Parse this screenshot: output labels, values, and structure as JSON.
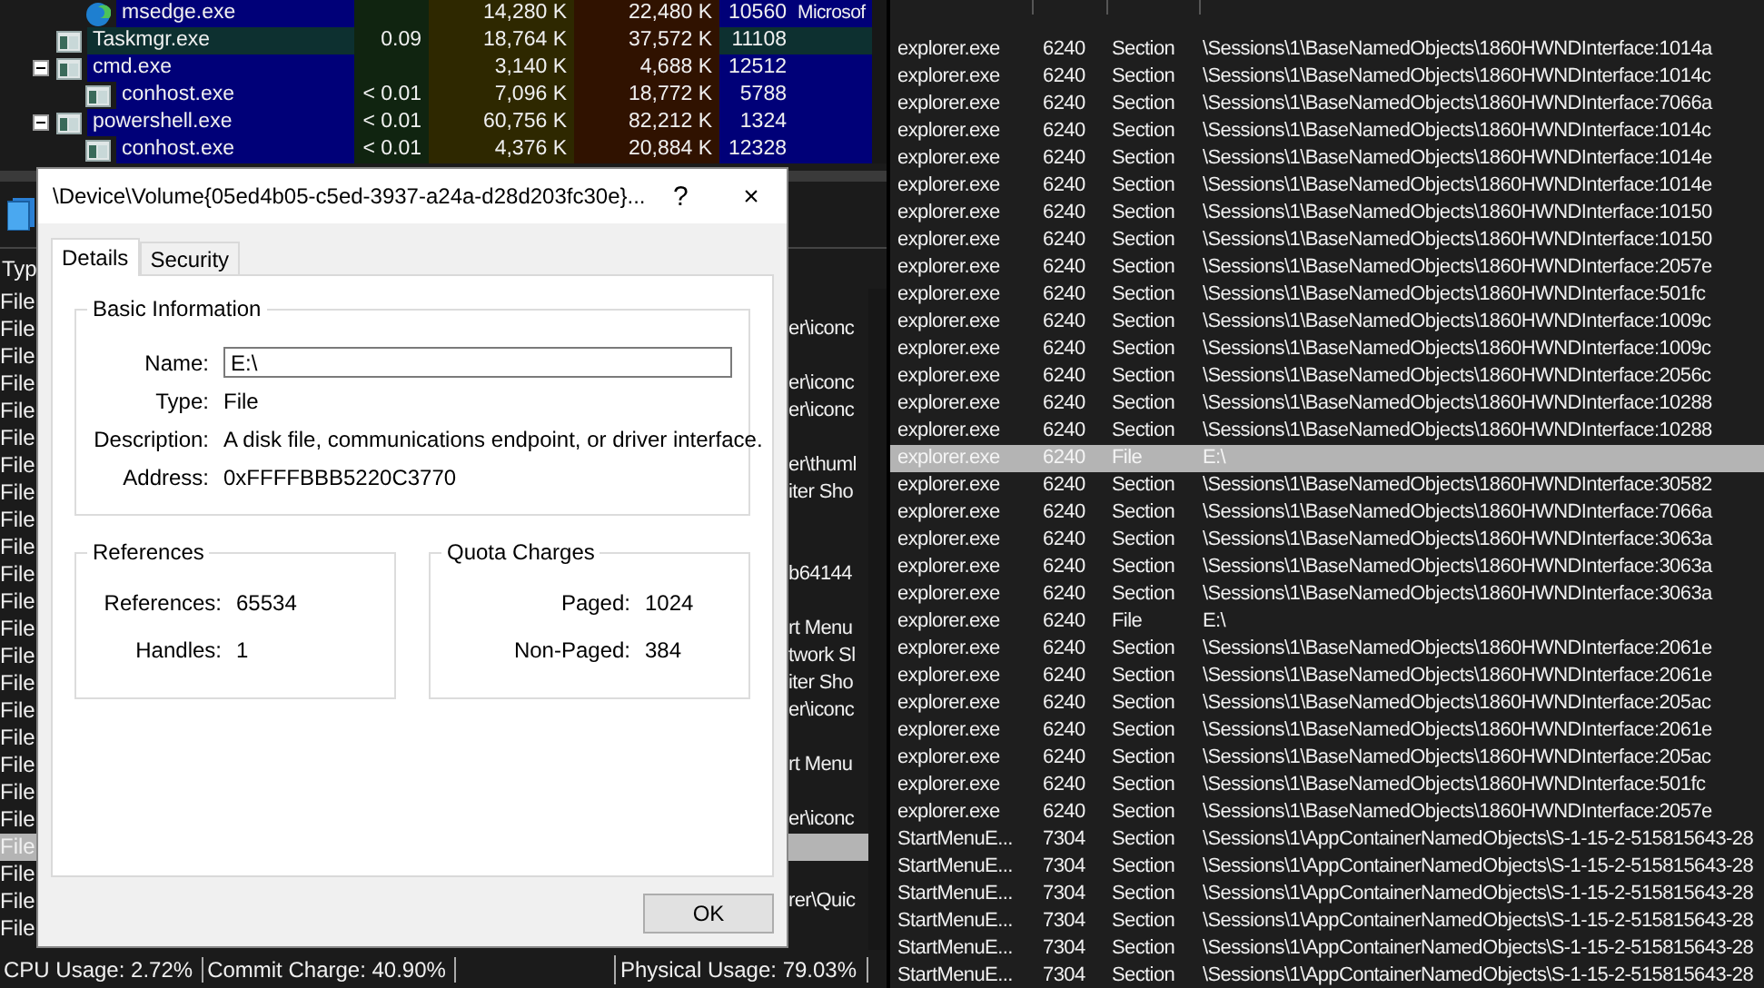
{
  "process_tree": {
    "leading_child_rows": [
      {
        "name": "msedge.exe",
        "cpu": "",
        "private_bytes": "14,280 K",
        "working_set": "22,480 K",
        "pid": "10560",
        "description": "Microsof",
        "highlighted": false
      }
    ],
    "rows": [
      {
        "name": "Taskmgr.exe",
        "cpu": "0.09",
        "private_bytes": "18,764 K",
        "working_set": "37,572 K",
        "pid": "11108",
        "highlighted": true
      },
      {
        "name": "cmd.exe",
        "cpu": "",
        "private_bytes": "3,140 K",
        "working_set": "4,688 K",
        "pid": "12512",
        "highlighted": false,
        "expanded": true,
        "children": [
          {
            "name": "conhost.exe",
            "cpu": "< 0.01",
            "private_bytes": "7,096 K",
            "working_set": "18,772 K",
            "pid": "5788",
            "highlighted": false
          }
        ]
      },
      {
        "name": "powershell.exe",
        "cpu": "< 0.01",
        "private_bytes": "60,756 K",
        "working_set": "82,212 K",
        "pid": "1324",
        "highlighted": false,
        "expanded": true,
        "children": [
          {
            "name": "conhost.exe",
            "cpu": "< 0.01",
            "private_bytes": "4,376 K",
            "working_set": "20,884 K",
            "pid": "12328",
            "highlighted": false
          }
        ]
      }
    ]
  },
  "lower_pane": {
    "header": "Typ",
    "rows": [
      {
        "type": "File",
        "selected": false
      },
      {
        "type": "File",
        "name_tail": "er\\iconc",
        "selected": false
      },
      {
        "type": "File",
        "selected": false
      },
      {
        "type": "File",
        "name_tail": "er\\iconc",
        "selected": false
      },
      {
        "type": "File",
        "name_tail": "er\\iconc",
        "selected": false
      },
      {
        "type": "File",
        "selected": false
      },
      {
        "type": "File",
        "name_tail": "er\\thuml",
        "selected": false
      },
      {
        "type": "File",
        "name_tail": "iter Sho",
        "selected": false
      },
      {
        "type": "File",
        "selected": false
      },
      {
        "type": "File",
        "selected": false
      },
      {
        "type": "File",
        "name_tail": "b64144",
        "selected": false
      },
      {
        "type": "File",
        "selected": false
      },
      {
        "type": "File",
        "name_tail": "rt Menu",
        "selected": false
      },
      {
        "type": "File",
        "name_tail": "twork Sl",
        "selected": false
      },
      {
        "type": "File",
        "name_tail": "iter Sho",
        "selected": false
      },
      {
        "type": "File",
        "name_tail": "er\\iconc",
        "selected": false
      },
      {
        "type": "File",
        "selected": false
      },
      {
        "type": "File",
        "name_tail": "rt Menu",
        "selected": false
      },
      {
        "type": "File",
        "selected": false
      },
      {
        "type": "File",
        "name_tail": "er\\iconc",
        "selected": false
      },
      {
        "type": "File",
        "selected": true
      },
      {
        "type": "File",
        "selected": false
      },
      {
        "type": "File",
        "name_tail": "rer\\Quic",
        "selected": false
      },
      {
        "type": "File",
        "selected": false
      }
    ]
  },
  "status_bar": [
    "CPU Usage: 2.72%",
    "Commit Charge: 40.90%",
    "Physical Usage: 79.03%"
  ],
  "dialog": {
    "title": "\\Device\\Volume{05ed4b05-c5ed-3937-a24a-d28d203fc30e}...",
    "help": "?",
    "close": "×",
    "tabs": [
      {
        "label": "Details",
        "selected": true
      },
      {
        "label": "Security",
        "selected": false
      }
    ],
    "basic_information": {
      "title": "Basic Information",
      "fields": [
        {
          "kind": "input",
          "label": "Name:",
          "value": "E:\\"
        },
        {
          "kind": "text",
          "label": "Type:",
          "value": "File"
        },
        {
          "kind": "text",
          "label": "Description:",
          "value": "A disk file, communications endpoint, or driver interface."
        },
        {
          "kind": "text",
          "label": "Address:",
          "value": "0xFFFFBBB5220C3770"
        }
      ]
    },
    "references": {
      "title": "References",
      "fields": [
        {
          "label": "References:",
          "value": "65534"
        },
        {
          "label": "Handles:",
          "value": "1"
        }
      ]
    },
    "quota_charges": {
      "title": "Quota Charges",
      "fields": [
        {
          "label": "Paged:",
          "value": "1024"
        },
        {
          "label": "Non-Paged:",
          "value": "384"
        }
      ]
    },
    "ok_button": "OK"
  },
  "handles": {
    "rows": [
      {
        "process": "explorer.exe",
        "pid": "6240",
        "type": "Section",
        "name": "\\Sessions\\1\\BaseNamedObjects\\1860HWNDInterface:1014a",
        "selected": false
      },
      {
        "process": "explorer.exe",
        "pid": "6240",
        "type": "Section",
        "name": "\\Sessions\\1\\BaseNamedObjects\\1860HWNDInterface:1014c",
        "selected": false
      },
      {
        "process": "explorer.exe",
        "pid": "6240",
        "type": "Section",
        "name": "\\Sessions\\1\\BaseNamedObjects\\1860HWNDInterface:7066a",
        "selected": false
      },
      {
        "process": "explorer.exe",
        "pid": "6240",
        "type": "Section",
        "name": "\\Sessions\\1\\BaseNamedObjects\\1860HWNDInterface:1014c",
        "selected": false
      },
      {
        "process": "explorer.exe",
        "pid": "6240",
        "type": "Section",
        "name": "\\Sessions\\1\\BaseNamedObjects\\1860HWNDInterface:1014e",
        "selected": false
      },
      {
        "process": "explorer.exe",
        "pid": "6240",
        "type": "Section",
        "name": "\\Sessions\\1\\BaseNamedObjects\\1860HWNDInterface:1014e",
        "selected": false
      },
      {
        "process": "explorer.exe",
        "pid": "6240",
        "type": "Section",
        "name": "\\Sessions\\1\\BaseNamedObjects\\1860HWNDInterface:10150",
        "selected": false
      },
      {
        "process": "explorer.exe",
        "pid": "6240",
        "type": "Section",
        "name": "\\Sessions\\1\\BaseNamedObjects\\1860HWNDInterface:10150",
        "selected": false
      },
      {
        "process": "explorer.exe",
        "pid": "6240",
        "type": "Section",
        "name": "\\Sessions\\1\\BaseNamedObjects\\1860HWNDInterface:2057e",
        "selected": false
      },
      {
        "process": "explorer.exe",
        "pid": "6240",
        "type": "Section",
        "name": "\\Sessions\\1\\BaseNamedObjects\\1860HWNDInterface:501fc",
        "selected": false
      },
      {
        "process": "explorer.exe",
        "pid": "6240",
        "type": "Section",
        "name": "\\Sessions\\1\\BaseNamedObjects\\1860HWNDInterface:1009c",
        "selected": false
      },
      {
        "process": "explorer.exe",
        "pid": "6240",
        "type": "Section",
        "name": "\\Sessions\\1\\BaseNamedObjects\\1860HWNDInterface:1009c",
        "selected": false
      },
      {
        "process": "explorer.exe",
        "pid": "6240",
        "type": "Section",
        "name": "\\Sessions\\1\\BaseNamedObjects\\1860HWNDInterface:2056c",
        "selected": false
      },
      {
        "process": "explorer.exe",
        "pid": "6240",
        "type": "Section",
        "name": "\\Sessions\\1\\BaseNamedObjects\\1860HWNDInterface:10288",
        "selected": false
      },
      {
        "process": "explorer.exe",
        "pid": "6240",
        "type": "Section",
        "name": "\\Sessions\\1\\BaseNamedObjects\\1860HWNDInterface:10288",
        "selected": false
      },
      {
        "process": "explorer.exe",
        "pid": "6240",
        "type": "File",
        "name": "E:\\",
        "selected": true
      },
      {
        "process": "explorer.exe",
        "pid": "6240",
        "type": "Section",
        "name": "\\Sessions\\1\\BaseNamedObjects\\1860HWNDInterface:30582",
        "selected": false
      },
      {
        "process": "explorer.exe",
        "pid": "6240",
        "type": "Section",
        "name": "\\Sessions\\1\\BaseNamedObjects\\1860HWNDInterface:7066a",
        "selected": false
      },
      {
        "process": "explorer.exe",
        "pid": "6240",
        "type": "Section",
        "name": "\\Sessions\\1\\BaseNamedObjects\\1860HWNDInterface:3063a",
        "selected": false
      },
      {
        "process": "explorer.exe",
        "pid": "6240",
        "type": "Section",
        "name": "\\Sessions\\1\\BaseNamedObjects\\1860HWNDInterface:3063a",
        "selected": false
      },
      {
        "process": "explorer.exe",
        "pid": "6240",
        "type": "Section",
        "name": "\\Sessions\\1\\BaseNamedObjects\\1860HWNDInterface:3063a",
        "selected": false
      },
      {
        "process": "explorer.exe",
        "pid": "6240",
        "type": "File",
        "name": "E:\\",
        "selected": false
      },
      {
        "process": "explorer.exe",
        "pid": "6240",
        "type": "Section",
        "name": "\\Sessions\\1\\BaseNamedObjects\\1860HWNDInterface:2061e",
        "selected": false
      },
      {
        "process": "explorer.exe",
        "pid": "6240",
        "type": "Section",
        "name": "\\Sessions\\1\\BaseNamedObjects\\1860HWNDInterface:2061e",
        "selected": false
      },
      {
        "process": "explorer.exe",
        "pid": "6240",
        "type": "Section",
        "name": "\\Sessions\\1\\BaseNamedObjects\\1860HWNDInterface:205ac",
        "selected": false
      },
      {
        "process": "explorer.exe",
        "pid": "6240",
        "type": "Section",
        "name": "\\Sessions\\1\\BaseNamedObjects\\1860HWNDInterface:2061e",
        "selected": false
      },
      {
        "process": "explorer.exe",
        "pid": "6240",
        "type": "Section",
        "name": "\\Sessions\\1\\BaseNamedObjects\\1860HWNDInterface:205ac",
        "selected": false
      },
      {
        "process": "explorer.exe",
        "pid": "6240",
        "type": "Section",
        "name": "\\Sessions\\1\\BaseNamedObjects\\1860HWNDInterface:501fc",
        "selected": false
      },
      {
        "process": "explorer.exe",
        "pid": "6240",
        "type": "Section",
        "name": "\\Sessions\\1\\BaseNamedObjects\\1860HWNDInterface:2057e",
        "selected": false
      },
      {
        "process": "StartMenuE...",
        "pid": "7304",
        "type": "Section",
        "name": "\\Sessions\\1\\AppContainerNamedObjects\\S-1-15-2-515815643-28",
        "selected": false
      },
      {
        "process": "StartMenuE...",
        "pid": "7304",
        "type": "Section",
        "name": "\\Sessions\\1\\AppContainerNamedObjects\\S-1-15-2-515815643-28",
        "selected": false
      },
      {
        "process": "StartMenuE...",
        "pid": "7304",
        "type": "Section",
        "name": "\\Sessions\\1\\AppContainerNamedObjects\\S-1-15-2-515815643-28",
        "selected": false
      },
      {
        "process": "StartMenuE...",
        "pid": "7304",
        "type": "Section",
        "name": "\\Sessions\\1\\AppContainerNamedObjects\\S-1-15-2-515815643-28",
        "selected": false
      },
      {
        "process": "StartMenuE...",
        "pid": "7304",
        "type": "Section",
        "name": "\\Sessions\\1\\AppContainerNamedObjects\\S-1-15-2-515815643-28",
        "selected": false
      },
      {
        "process": "StartMenuE...",
        "pid": "7304",
        "type": "Section",
        "name": "\\Sessions\\1\\AppContainerNamedObjects\\S-1-15-2-515815643-28",
        "selected": false
      }
    ]
  }
}
